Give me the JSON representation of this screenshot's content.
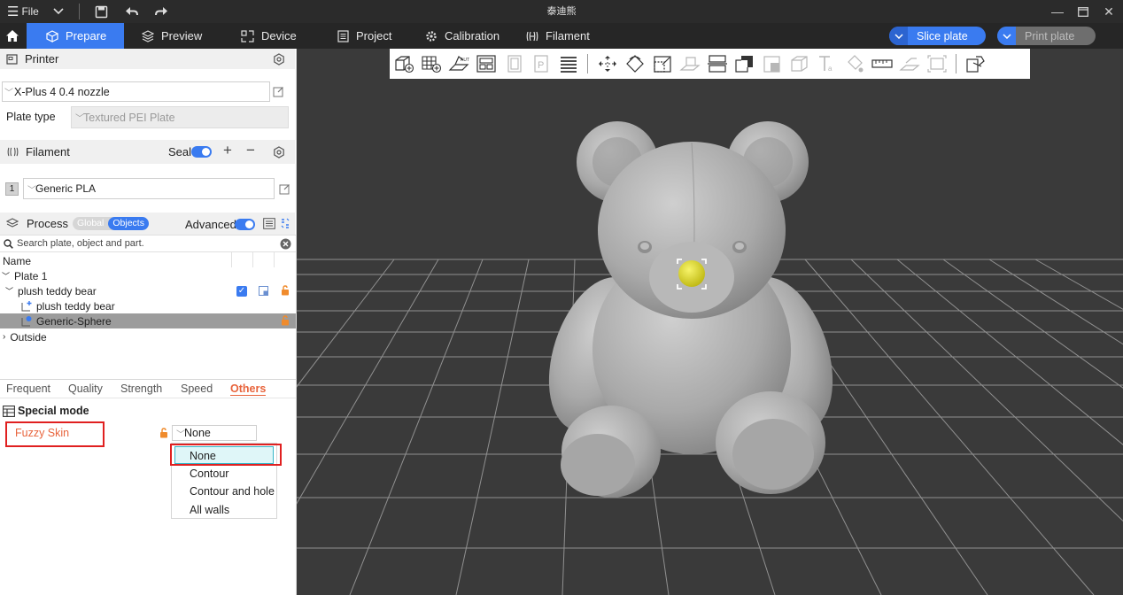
{
  "window": {
    "title": "泰迪熊",
    "menu_label": "File"
  },
  "tabs": [
    {
      "label": "Prepare",
      "icon": "cube-icon",
      "active": true
    },
    {
      "label": "Preview",
      "icon": "layers-icon"
    },
    {
      "label": "Device",
      "icon": "device-icon"
    },
    {
      "label": "Project",
      "icon": "document-icon"
    },
    {
      "label": "Calibration",
      "icon": "gear-icon"
    },
    {
      "label": "Filament",
      "icon": "spool-icon"
    }
  ],
  "actions": {
    "slice_label": "Slice plate",
    "print_label": "Print plate"
  },
  "printer": {
    "section_label": "Printer",
    "selected_printer": "X-Plus 4 0.4 nozzle",
    "plate_type_label": "Plate type",
    "plate_type_value": "Textured PEI Plate"
  },
  "filament": {
    "section_label": "Filament",
    "seal_label": "Seal",
    "slot_number": "1",
    "selected": "Generic PLA"
  },
  "process": {
    "section_label": "Process",
    "global_label": "Global",
    "objects_label": "Objects",
    "advanced_label": "Advanced",
    "search_placeholder": "Search plate, object and part."
  },
  "object_tree": {
    "column_name": "Name",
    "rows": [
      "Plate 1",
      "plush teddy bear",
      "plush teddy bear",
      "Generic-Sphere",
      "Outside"
    ]
  },
  "param_tabs": [
    "Frequent",
    "Quality",
    "Strength",
    "Speed",
    "Others"
  ],
  "special_mode": {
    "heading": "Special mode",
    "setting_label": "Fuzzy Skin",
    "current_value": "None",
    "options": [
      "None",
      "Contour",
      "Contour and hole",
      "All walls"
    ]
  },
  "colors": {
    "accent": "#3a7bf0",
    "active_tab_text": "#e8643c",
    "highlight_box": "#e02020",
    "bed_background": "#3a3a3a",
    "model_gray": "#a8a8a8",
    "sphere_yellow": "#e3de2a"
  }
}
